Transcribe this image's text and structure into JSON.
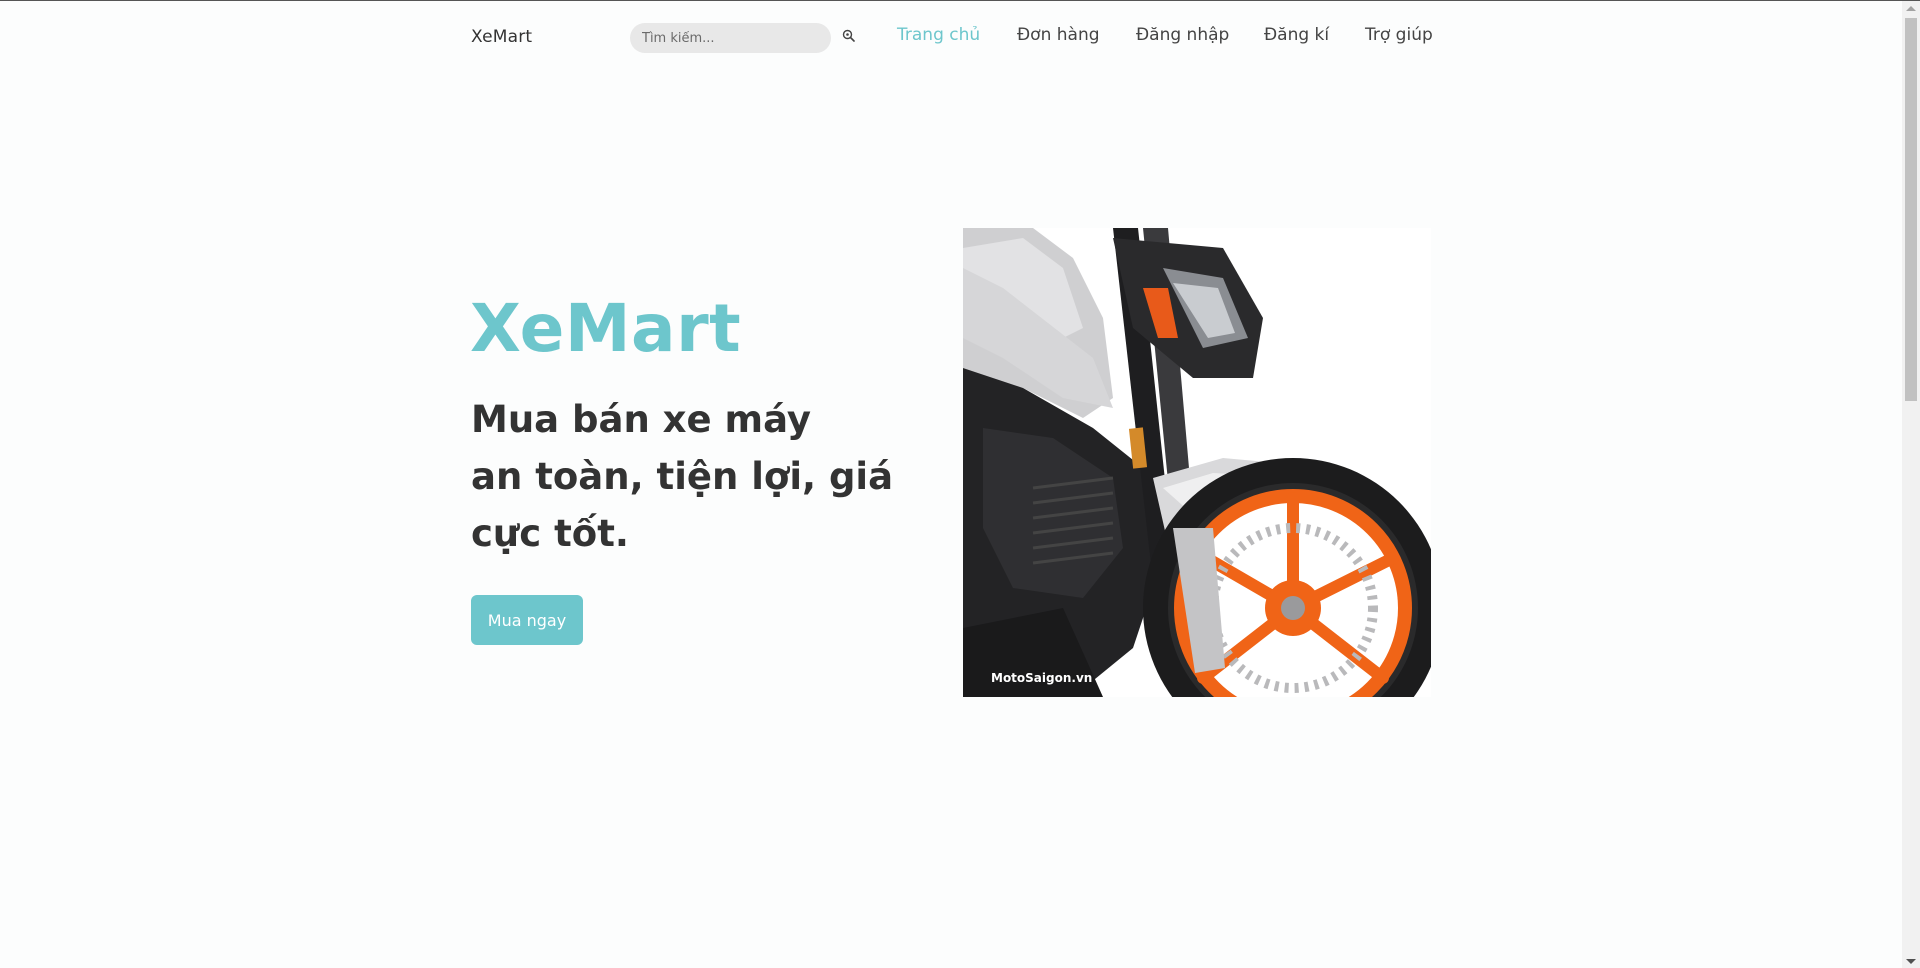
{
  "header": {
    "logo": "XeMart",
    "search": {
      "placeholder": "Tìm kiếm...",
      "value": ""
    },
    "nav": [
      {
        "label": "Trang chủ",
        "active": true
      },
      {
        "label": "Đơn hàng",
        "active": false
      },
      {
        "label": "Đăng nhập",
        "active": false
      },
      {
        "label": "Đăng kí",
        "active": false
      },
      {
        "label": "Trợ giúp",
        "active": false
      }
    ]
  },
  "hero": {
    "brand": "XeMart",
    "tagline_line1": "Mua bán xe máy",
    "tagline_line2": "an toàn, tiện lợi, giá cực tốt.",
    "cta_label": "Mua ngay",
    "image_watermark": "MotoSaigon.vn"
  },
  "colors": {
    "accent": "#6dc6cc",
    "text": "#333333",
    "background": "#fcfdfd"
  },
  "icons": {
    "search": "search-icon"
  }
}
